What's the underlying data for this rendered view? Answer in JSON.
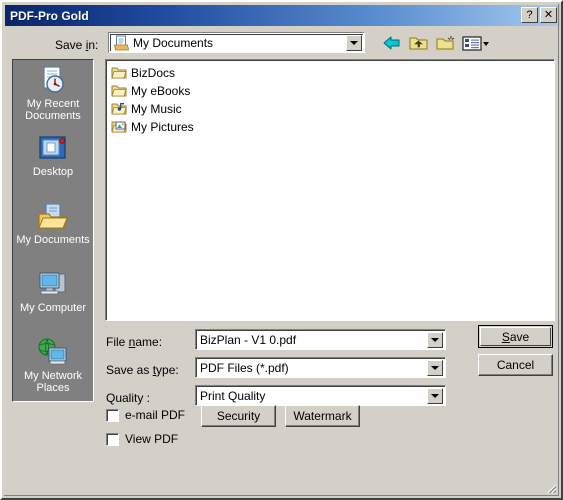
{
  "window": {
    "title": "PDF-Pro Gold",
    "help_button": "?",
    "close_button": "✕"
  },
  "savein": {
    "label_before": "Save ",
    "label_accel": "i",
    "label_after": "n:",
    "value": "My Documents",
    "icon": "my-documents-folder-icon"
  },
  "toolbar": {
    "items": [
      {
        "name": "back-icon",
        "tooltip": "Back"
      },
      {
        "name": "up-one-level-icon",
        "tooltip": "Up One Level"
      },
      {
        "name": "create-new-folder-icon",
        "tooltip": "Create New Folder"
      },
      {
        "name": "views-icon",
        "tooltip": "Views"
      }
    ]
  },
  "placesbar": {
    "items": [
      {
        "label": "My Recent Documents",
        "icon": "recent-documents-icon"
      },
      {
        "label": "Desktop",
        "icon": "desktop-icon"
      },
      {
        "label": "My Documents",
        "icon": "my-documents-icon"
      },
      {
        "label": "My Computer",
        "icon": "my-computer-icon"
      },
      {
        "label": "My Network Places",
        "icon": "my-network-places-icon"
      }
    ]
  },
  "filelist": {
    "items": [
      {
        "name": "BizDocs",
        "icon": "folder-icon"
      },
      {
        "name": "My eBooks",
        "icon": "folder-icon"
      },
      {
        "name": "My Music",
        "icon": "music-folder-icon"
      },
      {
        "name": "My Pictures",
        "icon": "pictures-folder-icon"
      }
    ]
  },
  "form": {
    "filename": {
      "label_before": "File ",
      "label_accel": "n",
      "label_after": "ame:",
      "value": "BizPlan - V1 0.pdf"
    },
    "filetype": {
      "label_before": "Save as ",
      "label_accel": "t",
      "label_after": "ype:",
      "value": "PDF Files (*.pdf)"
    },
    "quality": {
      "label_before": "Quality :",
      "label_accel": "",
      "label_after": "",
      "value": "Print Quality"
    }
  },
  "options": {
    "email_pdf": {
      "label": "e-mail PDF",
      "checked": false
    },
    "view_pdf": {
      "label": "View PDF",
      "checked": false
    }
  },
  "buttons": {
    "security": "Security",
    "watermark": "Watermark",
    "save_before": "",
    "save_accel": "S",
    "save_after": "ave",
    "cancel": "Cancel"
  },
  "colors": {
    "title_start": "#0a246a",
    "title_end": "#a6caf0",
    "dialog_face": "#d4d0c8",
    "placesbar": "#808080",
    "list_bg": "#ffffff"
  }
}
